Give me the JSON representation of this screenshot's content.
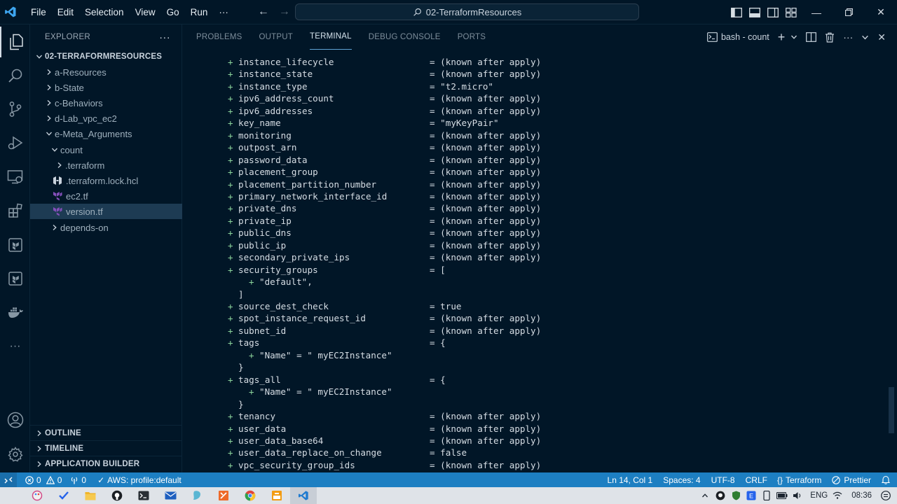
{
  "titlebar": {
    "menu": [
      "File",
      "Edit",
      "Selection",
      "View",
      "Go",
      "Run"
    ],
    "more": "···",
    "search_text": "02-TerraformResources"
  },
  "sidebar": {
    "header": "EXPLORER",
    "more": "···",
    "root": "02-TERRAFORMRESOURCES",
    "items": [
      {
        "label": "a-Resources"
      },
      {
        "label": "b-State"
      },
      {
        "label": "c-Behaviors"
      },
      {
        "label": "d-Lab_vpc_ec2"
      },
      {
        "label": "e-Meta_Arguments"
      },
      {
        "label": "count"
      },
      {
        "label": ".terraform"
      },
      {
        "label": ".terraform.lock.hcl"
      },
      {
        "label": "ec2.tf"
      },
      {
        "label": "version.tf"
      },
      {
        "label": "depends-on"
      }
    ],
    "sections": [
      "OUTLINE",
      "TIMELINE",
      "APPLICATION BUILDER"
    ]
  },
  "panel": {
    "tabs": [
      "PROBLEMS",
      "OUTPUT",
      "TERMINAL",
      "DEBUG CONSOLE",
      "PORTS"
    ],
    "active_tab": "TERMINAL",
    "terminal_name": "bash - count"
  },
  "terminal": {
    "lines": [
      {
        "kind": "attr",
        "key": "instance_lifecycle",
        "val": "= (known after apply)"
      },
      {
        "kind": "attr",
        "key": "instance_state",
        "val": "= (known after apply)"
      },
      {
        "kind": "attr",
        "key": "instance_type",
        "val": "= \"t2.micro\""
      },
      {
        "kind": "attr",
        "key": "ipv6_address_count",
        "val": "= (known after apply)"
      },
      {
        "kind": "attr",
        "key": "ipv6_addresses",
        "val": "= (known after apply)"
      },
      {
        "kind": "attr",
        "key": "key_name",
        "val": "= \"myKeyPair\""
      },
      {
        "kind": "attr",
        "key": "monitoring",
        "val": "= (known after apply)"
      },
      {
        "kind": "attr",
        "key": "outpost_arn",
        "val": "= (known after apply)"
      },
      {
        "kind": "attr",
        "key": "password_data",
        "val": "= (known after apply)"
      },
      {
        "kind": "attr",
        "key": "placement_group",
        "val": "= (known after apply)"
      },
      {
        "kind": "attr",
        "key": "placement_partition_number",
        "val": "= (known after apply)"
      },
      {
        "kind": "attr",
        "key": "primary_network_interface_id",
        "val": "= (known after apply)"
      },
      {
        "kind": "attr",
        "key": "private_dns",
        "val": "= (known after apply)"
      },
      {
        "kind": "attr",
        "key": "private_ip",
        "val": "= (known after apply)"
      },
      {
        "kind": "attr",
        "key": "public_dns",
        "val": "= (known after apply)"
      },
      {
        "kind": "attr",
        "key": "public_ip",
        "val": "= (known after apply)"
      },
      {
        "kind": "attr",
        "key": "secondary_private_ips",
        "val": "= (known after apply)"
      },
      {
        "kind": "attr",
        "key": "security_groups",
        "val": "= ["
      },
      {
        "kind": "sub",
        "text": "\"default\","
      },
      {
        "kind": "close",
        "text": "]"
      },
      {
        "kind": "attr",
        "key": "source_dest_check",
        "val": "= true"
      },
      {
        "kind": "attr",
        "key": "spot_instance_request_id",
        "val": "= (known after apply)"
      },
      {
        "kind": "attr",
        "key": "subnet_id",
        "val": "= (known after apply)"
      },
      {
        "kind": "attr",
        "key": "tags",
        "val": "= {"
      },
      {
        "kind": "sub",
        "text": "\"Name\" = \" myEC2Instance\""
      },
      {
        "kind": "close",
        "text": "}"
      },
      {
        "kind": "attr",
        "key": "tags_all",
        "val": "= {"
      },
      {
        "kind": "sub",
        "text": "\"Name\" = \" myEC2Instance\""
      },
      {
        "kind": "close",
        "text": "}"
      },
      {
        "kind": "attr",
        "key": "tenancy",
        "val": "= (known after apply)"
      },
      {
        "kind": "attr",
        "key": "user_data",
        "val": "= (known after apply)"
      },
      {
        "kind": "attr",
        "key": "user_data_base64",
        "val": "= (known after apply)"
      },
      {
        "kind": "attr",
        "key": "user_data_replace_on_change",
        "val": "= false"
      },
      {
        "kind": "attr",
        "key": "vpc_security_group_ids",
        "val": "= (known after apply)"
      }
    ]
  },
  "statusbar": {
    "errors": "0",
    "warnings": "0",
    "ports": "0",
    "aws_profile": "AWS: profile:default",
    "position": "Ln 14, Col 1",
    "spaces": "Spaces: 4",
    "encoding": "UTF-8",
    "eol": "CRLF",
    "language": "Terraform",
    "formatter": "Prettier"
  },
  "taskbar": {
    "lang": "ENG",
    "time": "08:36"
  },
  "colors": {
    "background": "#011627",
    "statusbar": "#1d7fc2",
    "plus_sign": "#8bd49c",
    "terraform_purple": "#844fba"
  }
}
